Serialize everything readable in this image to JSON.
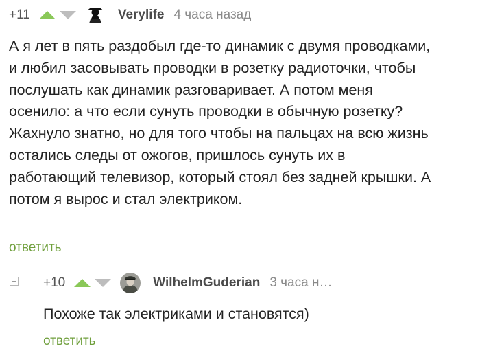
{
  "comment": {
    "rating": "+11",
    "username": "Verylife",
    "timestamp": "4 часа назад",
    "lines": [
      "А я лет в пять раздобыл где-то динамик с двумя проводками,",
      "и любил засовывать проводки в розетку радиоточки, чтобы",
      "послушать как динамик разговаривает. А потом меня",
      "осенило: а что если сунуть проводки в обычную розетку?",
      "Жахнуло знатно, но для того чтобы на пальцах на всю жизнь",
      "остались следы от ожогов, пришлось сунуть их в",
      "работающий телевизор, который стоял без задней крышки. А",
      "потом я вырос и стал электриком."
    ],
    "reply_label": "ответить"
  },
  "reply": {
    "rating": "+10",
    "username": "WilhelmGuderian",
    "timestamp": "3 часа н…",
    "text": "Похоже так электриками и становятся)",
    "reply_label": "ответить"
  },
  "icons": {
    "upvote": "upvote-arrow-icon",
    "downvote": "downvote-arrow-icon",
    "collapse": "collapse-thread-icon"
  },
  "colors": {
    "upvote": "#8ac858",
    "downvote": "#bdbdbd",
    "reply_link": "#6f9f3c",
    "username": "#4a4a4a",
    "timestamp": "#8a8a8a"
  }
}
